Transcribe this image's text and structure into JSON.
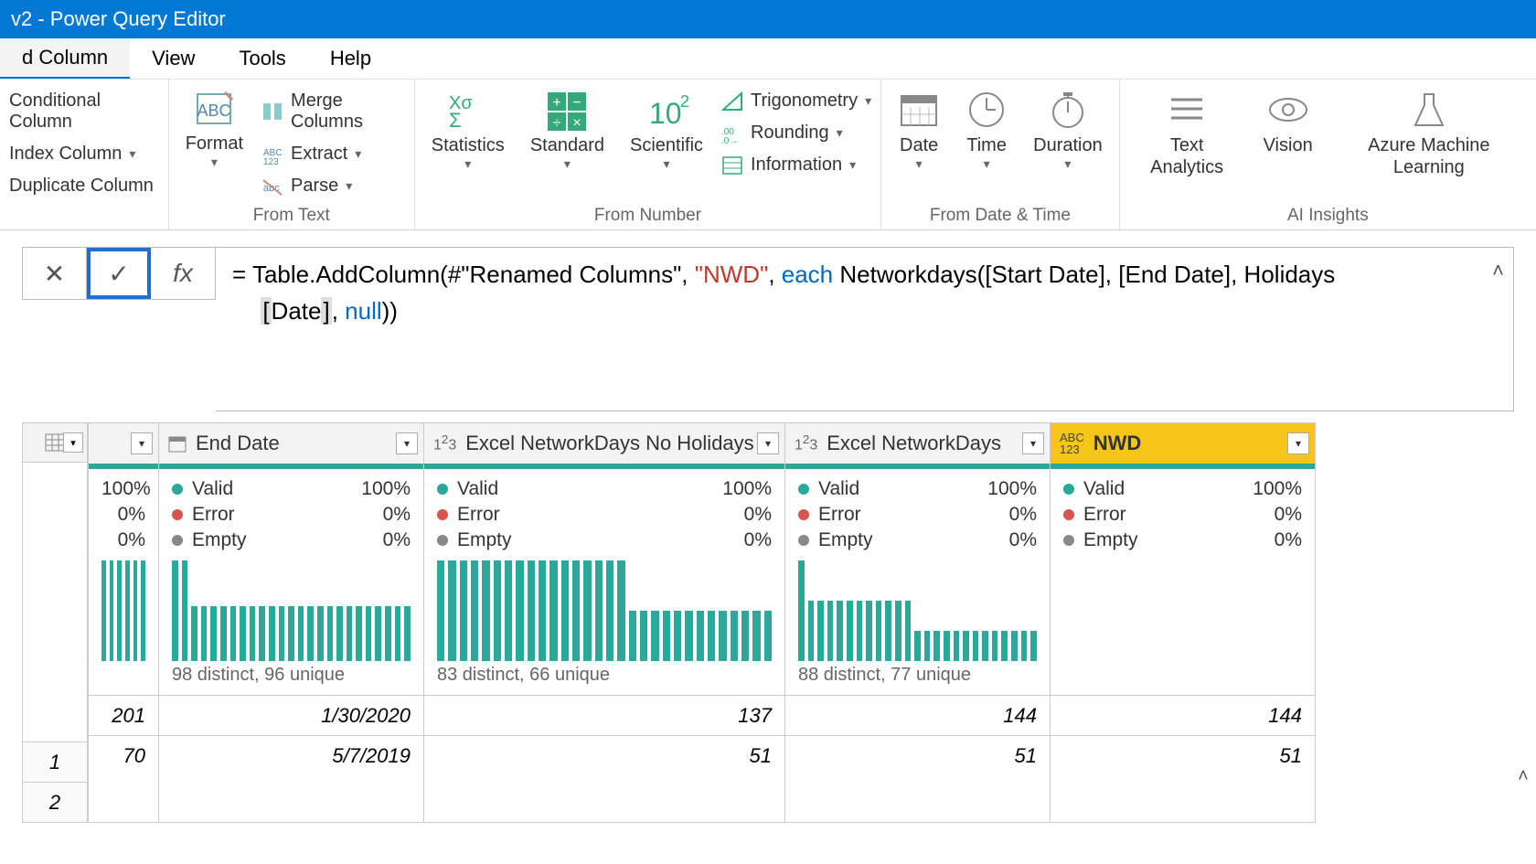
{
  "window": {
    "title": "v2 - Power Query Editor"
  },
  "tabs": {
    "t0": "d Column",
    "t1": "View",
    "t2": "Tools",
    "t3": "Help"
  },
  "ribbon": {
    "col_group_items": {
      "conditional": "Conditional Column",
      "index": "Index Column",
      "duplicate": "Duplicate Column"
    },
    "format": "Format",
    "text_group": {
      "merge": "Merge Columns",
      "extract": "Extract",
      "parse": "Parse",
      "label": "From Text"
    },
    "number_group": {
      "stats": "Statistics",
      "standard": "Standard",
      "scientific": "Scientific",
      "trig": "Trigonometry",
      "rounding": "Rounding",
      "info": "Information",
      "label": "From Number"
    },
    "datetime_group": {
      "date": "Date",
      "time": "Time",
      "duration": "Duration",
      "label": "From Date & Time"
    },
    "ai_group": {
      "text": "Text Analytics",
      "vision": "Vision",
      "aml": "Azure Machine Learning",
      "label": "AI Insights"
    }
  },
  "formula": {
    "prefix": "= Table.AddColumn(#\"Renamed Columns\", ",
    "str": "\"NWD\"",
    "mid1": ", ",
    "each": "each",
    "mid2": " Networkdays([Start Date], [End Date], Holidays",
    "line2_pre": "[Date",
    "line2_bracket": "]",
    "line2_mid": ", ",
    "null": "null",
    "line2_end": "))"
  },
  "columns": {
    "c0": {
      "name": "",
      "valid": "100%",
      "error": "0%",
      "empty": "0%",
      "distinct": ""
    },
    "c1": {
      "name": "End Date",
      "valid": "Valid",
      "validpct": "100%",
      "error": "Error",
      "errorpct": "0%",
      "empty": "Empty",
      "emptypct": "0%",
      "distinct": "98 distinct, 96 unique"
    },
    "c2": {
      "name": "Excel NetworkDays No Holidays",
      "valid": "Valid",
      "validpct": "100%",
      "error": "Error",
      "errorpct": "0%",
      "empty": "Empty",
      "emptypct": "0%",
      "distinct": "83 distinct, 66 unique"
    },
    "c3": {
      "name": "Excel NetworkDays",
      "valid": "Valid",
      "validpct": "100%",
      "error": "Error",
      "errorpct": "0%",
      "empty": "Empty",
      "emptypct": "0%",
      "distinct": "88 distinct, 77 unique"
    },
    "c4": {
      "name": "NWD",
      "valid": "Valid",
      "validpct": "100%",
      "error": "Error",
      "errorpct": "0%",
      "empty": "Empty",
      "emptypct": "0%",
      "distinct": ""
    }
  },
  "rows": {
    "r1": {
      "idx": "1",
      "c0": "201",
      "c1": "1/30/2020",
      "c2": "137",
      "c3": "144",
      "c4": "144"
    },
    "r2": {
      "idx": "2",
      "c0": "70",
      "c1": "5/7/2019",
      "c2": "51",
      "c3": "51",
      "c4": "51"
    }
  }
}
